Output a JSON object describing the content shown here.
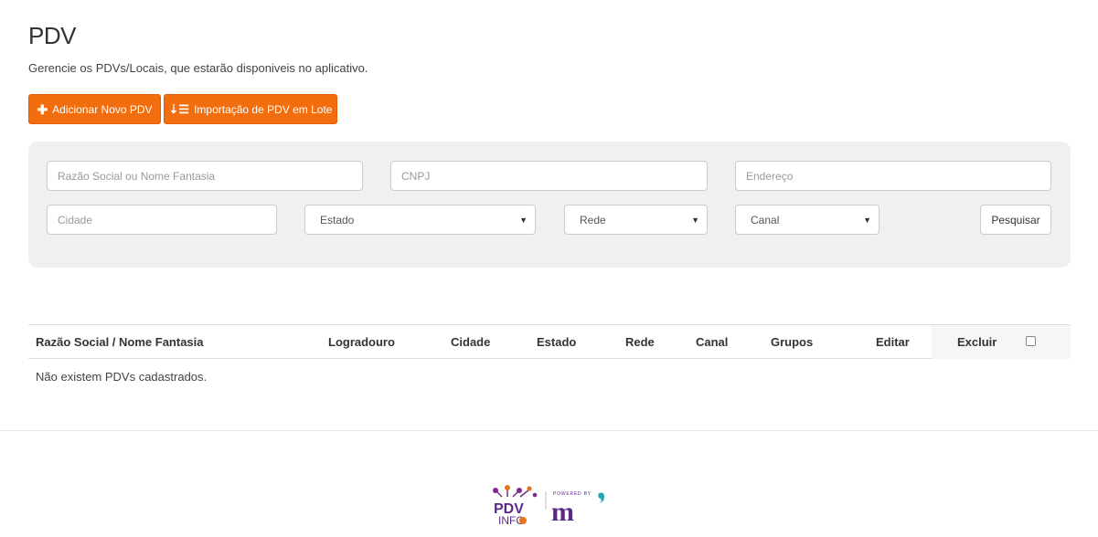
{
  "header": {
    "title": "PDV",
    "subtitle": "Gerencie os PDVs/Locais, que estarão disponiveis no aplicativo."
  },
  "actions": {
    "add_label": "Adicionar Novo PDV",
    "add_icon": "plus-icon",
    "import_label": "Importação de PDV em Lote",
    "import_icon": "sort-amount-icon",
    "accent_color": "#f26d0e"
  },
  "filters": {
    "razao_placeholder": "Razão Social ou Nome Fantasia",
    "cnpj_placeholder": "CNPJ",
    "endereco_placeholder": "Endereço",
    "cidade_placeholder": "Cidade",
    "estado_selected": "Estado",
    "rede_selected": "Rede",
    "canal_selected": "Canal",
    "search_label": "Pesquisar"
  },
  "table": {
    "columns": [
      "Razão Social / Nome Fantasia",
      "Logradouro",
      "Cidade",
      "Estado",
      "Rede",
      "Canal",
      "Grupos",
      "Editar",
      "Excluir"
    ],
    "empty_message": "Não existem PDVs cadastrados."
  },
  "footer": {
    "logo_text_top": "PDV",
    "logo_text_bottom": "INFO",
    "powered_by": "POWERED BY",
    "brand_mark": "m"
  }
}
